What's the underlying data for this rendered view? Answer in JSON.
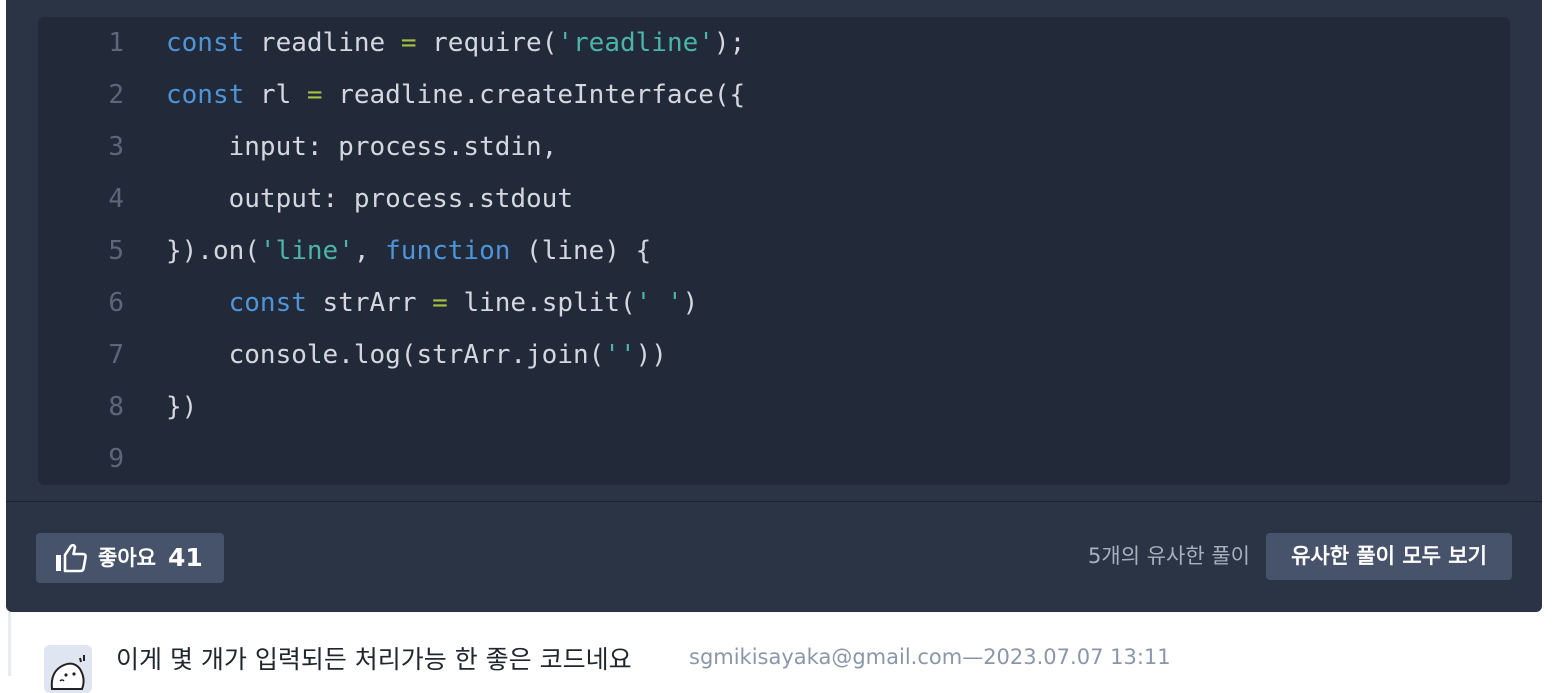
{
  "code": {
    "lines": [
      {
        "n": "1",
        "tokens": [
          [
            "kw",
            "const"
          ],
          [
            "p",
            " readline "
          ],
          [
            "op",
            "="
          ],
          [
            "p",
            " require("
          ],
          [
            "str",
            "'readline'"
          ],
          [
            "p",
            ");"
          ]
        ]
      },
      {
        "n": "2",
        "tokens": [
          [
            "kw",
            "const"
          ],
          [
            "p",
            " rl "
          ],
          [
            "op",
            "="
          ],
          [
            "p",
            " readline.createInterface({"
          ]
        ]
      },
      {
        "n": "3",
        "tokens": [
          [
            "p",
            "    input: process.stdin,"
          ]
        ]
      },
      {
        "n": "4",
        "tokens": [
          [
            "p",
            "    output: process.stdout"
          ]
        ]
      },
      {
        "n": "5",
        "tokens": [
          [
            "p",
            "}).on("
          ],
          [
            "str",
            "'line'"
          ],
          [
            "p",
            ", "
          ],
          [
            "kw",
            "function"
          ],
          [
            "p",
            " (line) {"
          ]
        ]
      },
      {
        "n": "6",
        "tokens": [
          [
            "p",
            "    "
          ],
          [
            "kw",
            "const"
          ],
          [
            "p",
            " strArr "
          ],
          [
            "op",
            "="
          ],
          [
            "p",
            " line.split("
          ],
          [
            "str",
            "' '"
          ],
          [
            "p",
            ")"
          ]
        ]
      },
      {
        "n": "7",
        "tokens": [
          [
            "p",
            "    console.log(strArr.join("
          ],
          [
            "str",
            "''"
          ],
          [
            "p",
            "))"
          ]
        ]
      },
      {
        "n": "8",
        "tokens": [
          [
            "p",
            "})"
          ]
        ]
      },
      {
        "n": "9",
        "tokens": []
      }
    ]
  },
  "actions": {
    "like_label": "좋아요",
    "like_count": "41",
    "similar_count_text": "5개의 유사한 풀이",
    "similar_button_label": "유사한 풀이 모두 보기"
  },
  "comment": {
    "text": "이게 몇 개가 입력되든 처리가능 한 좋은 코드네요",
    "author": "sgmikisayaka@gmail.com",
    "separator": "—",
    "timestamp": "2023.07.07 13:11"
  },
  "colors": {
    "card_bg": "#2b3444",
    "code_bg": "#222a3a",
    "keyword": "#4d95d8",
    "string": "#4bb5a5",
    "operator": "#a8c03f",
    "button_bg": "#46536a"
  },
  "icons": {
    "like": "thumbs-up-icon",
    "avatar": "user-avatar"
  }
}
